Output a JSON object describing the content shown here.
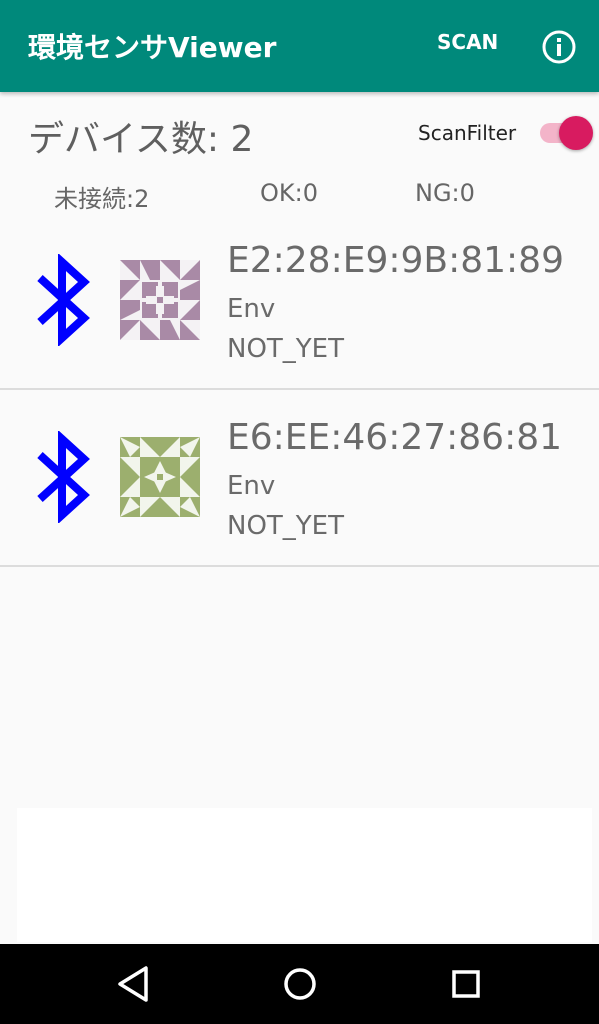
{
  "colors": {
    "primary": "#00897b",
    "accent": "#d81b60",
    "bluetooth": "#0000ff"
  },
  "appbar": {
    "title": "環境センサViewer",
    "scan_label": "SCAN",
    "info_icon": "info-icon"
  },
  "summary": {
    "device_count_text": "デバイス数: 2",
    "scan_filter_label": "ScanFilter",
    "scan_filter_on": true,
    "stats": [
      "未接続:2",
      "OK:0",
      "NG:0"
    ]
  },
  "devices": [
    {
      "address": "E2:28:E9:9B:81:89",
      "type": "Env",
      "status": "NOT_YET",
      "icon": "bluetooth-icon",
      "avatar_color": "#a98aa6"
    },
    {
      "address": "E6:EE:46:27:86:81",
      "type": "Env",
      "status": "NOT_YET",
      "icon": "bluetooth-icon",
      "avatar_color": "#9caf6e"
    }
  ],
  "navbar": {
    "icons": [
      "back-icon",
      "home-icon",
      "recent-apps-icon"
    ]
  }
}
